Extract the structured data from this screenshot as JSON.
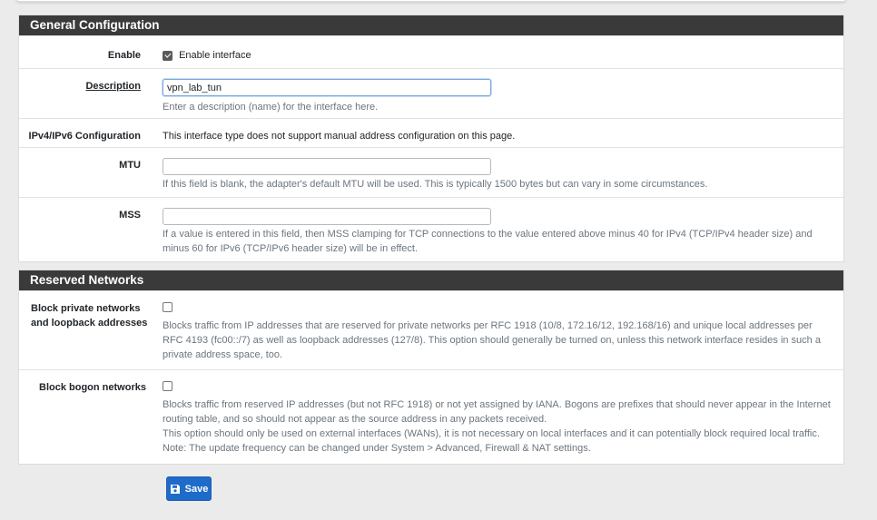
{
  "general": {
    "heading": "General Configuration",
    "enable": {
      "label": "Enable",
      "checkbox_label": "Enable interface",
      "checked": true
    },
    "description": {
      "label": "Description",
      "value": "vpn_lab_tun",
      "help": "Enter a description (name) for the interface here."
    },
    "ip_config": {
      "label": "IPv4/IPv6 Configuration",
      "text": "This interface type does not support manual address configuration on this page."
    },
    "mtu": {
      "label": "MTU",
      "value": "",
      "help": "If this field is blank, the adapter's default MTU will be used. This is typically 1500 bytes but can vary in some circumstances."
    },
    "mss": {
      "label": "MSS",
      "value": "",
      "help_line1": "If a value is entered in this field, then MSS clamping for TCP connections to the value entered above minus 40 for IPv4 (TCP/IPv4 header size) and",
      "help_line2": "minus 60 for IPv6 (TCP/IPv6 header size) will be in effect."
    }
  },
  "reserved": {
    "heading": "Reserved Networks",
    "block_private": {
      "label_line1": "Block private networks",
      "label_line2": "and loopback addresses",
      "checked": false,
      "help_line1": "Blocks traffic from IP addresses that are reserved for private networks per RFC 1918 (10/8, 172.16/12, 192.168/16) and unique local addresses per",
      "help_line2": "RFC 4193 (fc00::/7) as well as loopback addresses (127/8). This option should generally be turned on, unless this network interface resides in such a",
      "help_line3": "private address space, too."
    },
    "block_bogon": {
      "label": "Block bogon networks",
      "checked": false,
      "help_line1": "Blocks traffic from reserved IP addresses (but not RFC 1918) or not yet assigned by IANA. Bogons are prefixes that should never appear in the Internet",
      "help_line2": "routing table, and so should not appear as the source address in any packets received.",
      "help_line3": "This option should only be used on external interfaces (WANs), it is not necessary on local interfaces and it can potentially block required local traffic.",
      "help_line4": "Note: The update frequency can be changed under System > Advanced, Firewall & NAT settings."
    }
  },
  "save_label": "Save",
  "icons": {
    "save": "floppy-disk-icon"
  }
}
